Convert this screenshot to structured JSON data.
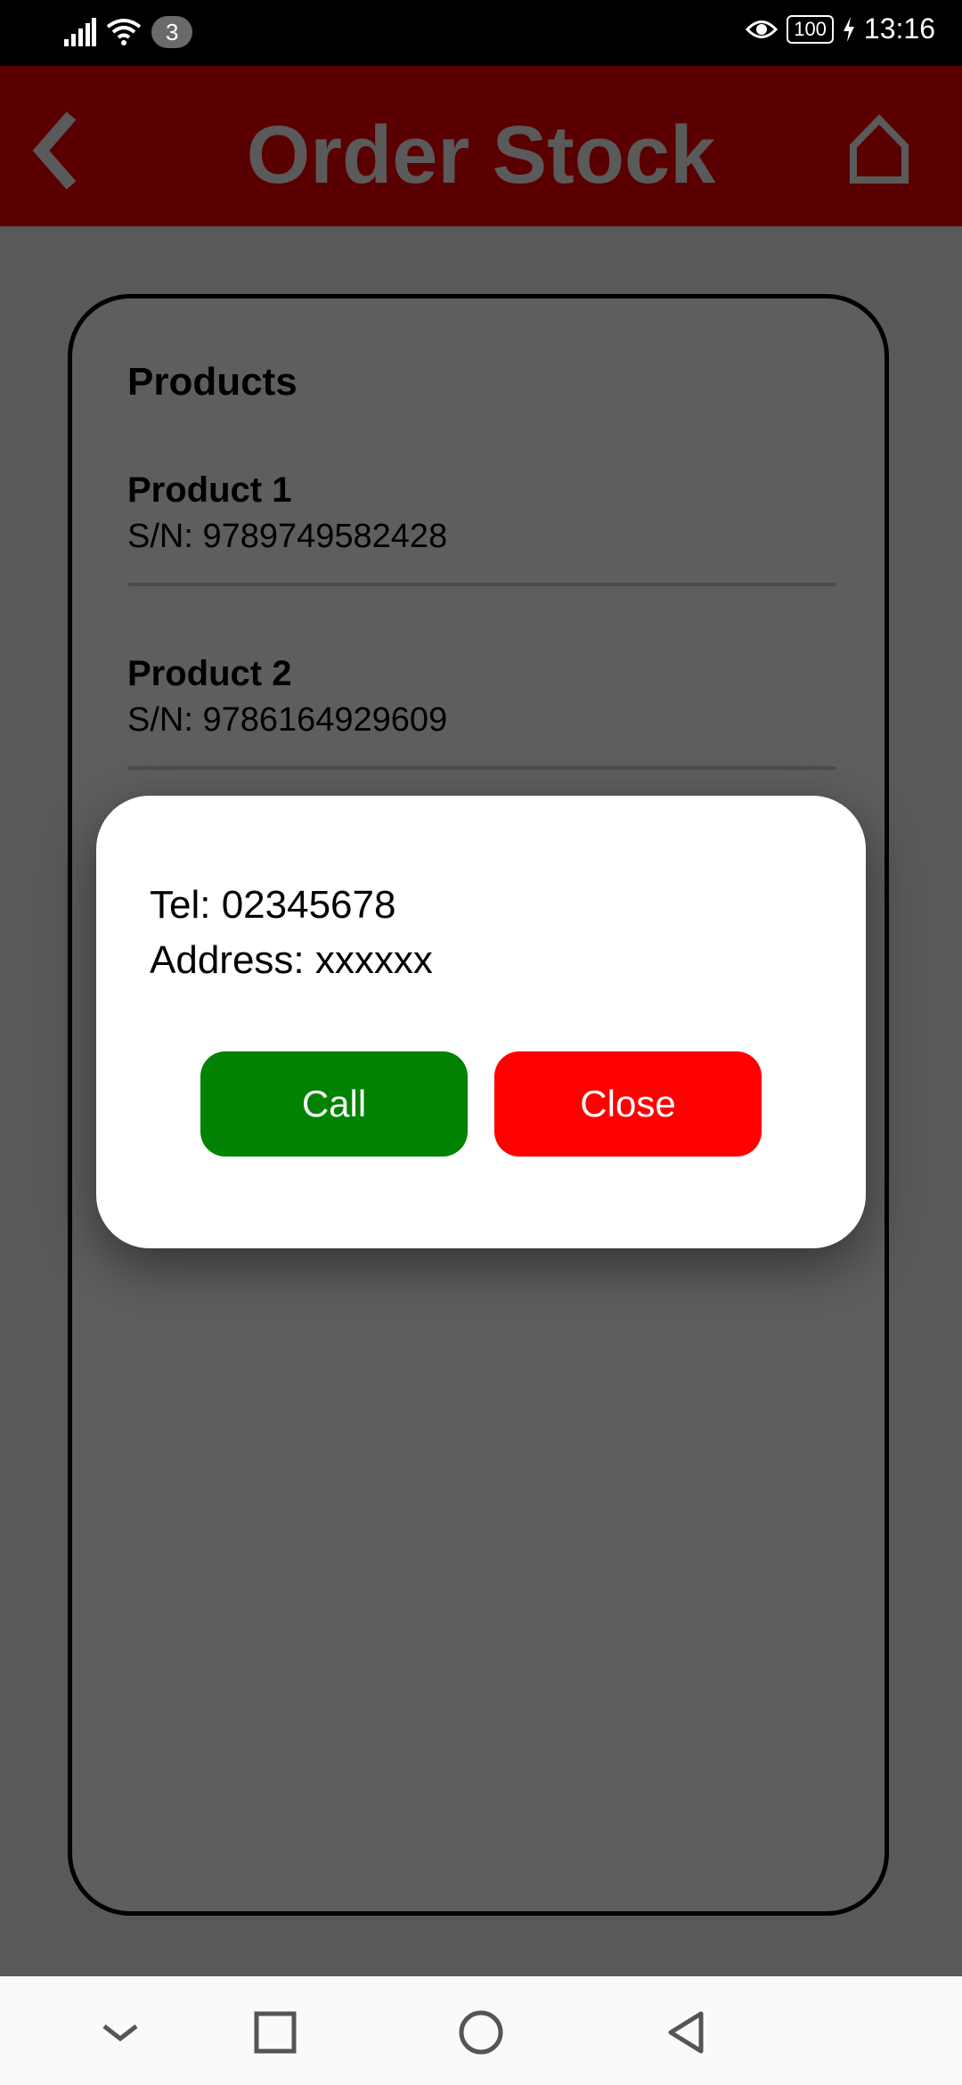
{
  "status_bar": {
    "notification_count": "3",
    "battery": "100",
    "time": "13:16",
    "icons": [
      "signal-icon",
      "wifi-icon",
      "eye-icon",
      "battery-icon",
      "charging-icon"
    ]
  },
  "app_bar": {
    "title": "Order Stock",
    "background": "#5b0000",
    "icons": [
      "back-icon",
      "home-icon"
    ]
  },
  "products": {
    "title": "Products",
    "items": [
      {
        "name": "Product 1",
        "sn": "S/N: 9789749582428"
      },
      {
        "name": "Product 2",
        "sn": "S/N: 9786164929609"
      }
    ]
  },
  "dialog": {
    "tel": "Tel: 02345678",
    "address": "Address: xxxxxx",
    "call_label": "Call",
    "close_label": "Close",
    "call_color": "#028202",
    "close_color": "#ff0000"
  },
  "nav_bar": {
    "icons": [
      "hide-nav-icon",
      "recents-icon",
      "home-circle-icon",
      "back-triangle-icon"
    ]
  }
}
